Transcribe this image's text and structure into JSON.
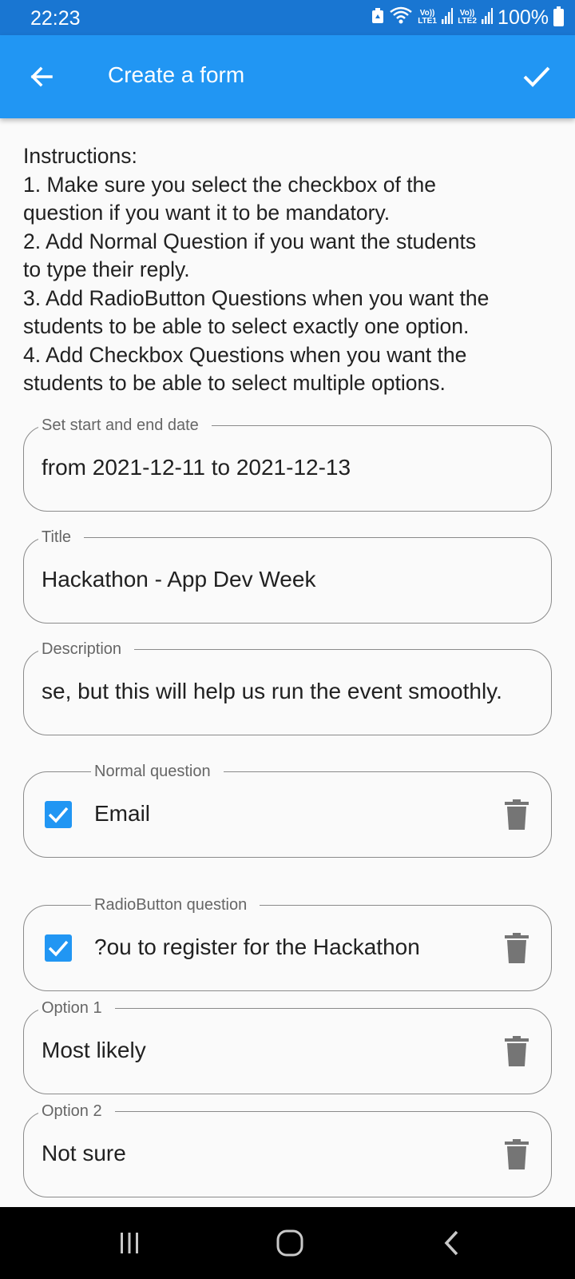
{
  "status_bar": {
    "time": "22:23",
    "sim1_label": "Vo)) LTE1",
    "sim2_label": "Vo)) LTE2",
    "battery": "100%"
  },
  "app_bar": {
    "title": "Create a form",
    "back_icon": "arrow-back-icon",
    "confirm_icon": "check-icon",
    "color": "#2196f3"
  },
  "instructions": {
    "lines": [
      "Instructions:",
      "1. Make sure you select the checkbox of the",
      "question if you want it to be mandatory.",
      "2. Add Normal Question if you want the students",
      "to type their reply.",
      "3. Add RadioButton Questions when you want the",
      "students to be able to select exactly one option.",
      "4. Add Checkbox Questions when you want the",
      "students to be able to select multiple options."
    ]
  },
  "fields": {
    "dates": {
      "label": "Set start and end date",
      "value": "from 2021-12-11 to 2021-12-13"
    },
    "title": {
      "label": "Title",
      "value": "Hackathon - App Dev Week"
    },
    "description": {
      "label": "Description",
      "value": "se, but this will help us run the event smoothly."
    }
  },
  "questions": {
    "normal": {
      "label": "Normal question",
      "value": "Email",
      "mandatory": true
    },
    "radio": {
      "label": "RadioButton question",
      "value": "ou to register for the Hackathon?",
      "mandatory": true
    },
    "options": [
      {
        "label": "Option 1",
        "value": "Most likely"
      },
      {
        "label": "Option 2",
        "value": "Not sure"
      }
    ]
  },
  "nav_bar": {
    "recents_icon": "recents-icon",
    "home_icon": "home-icon",
    "back_icon": "back-chevron-icon"
  }
}
